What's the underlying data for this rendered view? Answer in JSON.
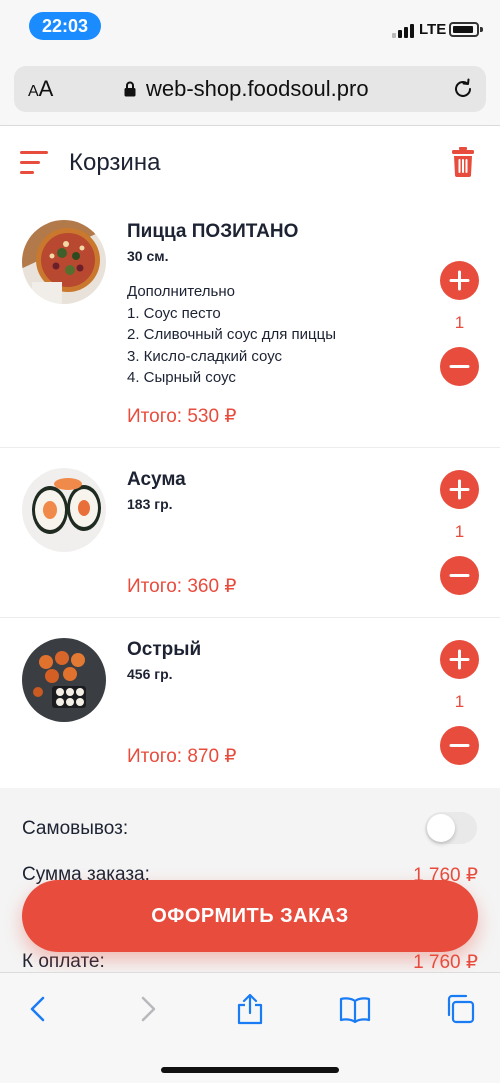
{
  "status_bar": {
    "time": "22:03",
    "network": "LTE"
  },
  "browser": {
    "aa_label_small": "A",
    "aa_label_large": "A",
    "url": "web-shop.foodsoul.pro"
  },
  "header": {
    "title": "Корзина"
  },
  "items": [
    {
      "name": "Пицца ПОЗИТАНО",
      "weight": "30 см.",
      "extras_title": "Дополнительно",
      "extras": [
        "1. Соус песто",
        "2. Сливочный соус для пиццы",
        "3. Кисло-сладкий соус",
        "4. Сырный соус"
      ],
      "total": "Итого: 530 ₽",
      "quantity": "1"
    },
    {
      "name": "Асума",
      "weight": "183 гр.",
      "total": "Итого: 360 ₽",
      "quantity": "1"
    },
    {
      "name": "Острый",
      "weight": "456 гр.",
      "total": "Итого: 870 ₽",
      "quantity": "1"
    }
  ],
  "summary": {
    "pickup_label": "Самовывоз:",
    "pickup_enabled": false,
    "order_sum_label": "Сумма заказа:",
    "order_sum_value": "1 760 ₽",
    "to_pay_label": "К оплате:",
    "to_pay_value": "1 760 ₽"
  },
  "checkout_label": "ОФОРМИТЬ ЗАКАЗ",
  "colors": {
    "accent": "#e84c3d",
    "text": "#1d2333",
    "ios_blue": "#1a8cff"
  }
}
